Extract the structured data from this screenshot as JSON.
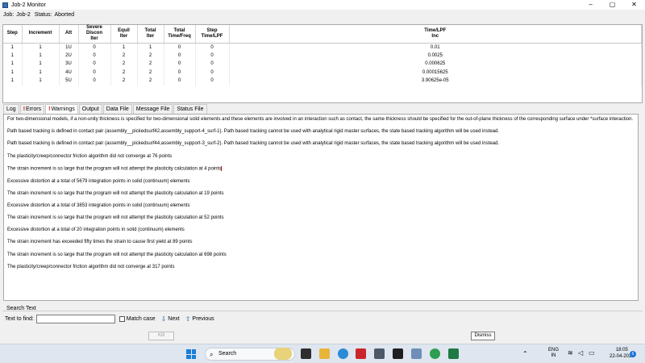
{
  "window": {
    "title": "Job-2 Monitor",
    "minimize": "–",
    "maximize": "▢",
    "close": "✕"
  },
  "job": {
    "job_label": "Job:",
    "job_value": "Job-2",
    "status_label": "Status:",
    "status_value": "Aborted"
  },
  "table": {
    "headers": [
      "Step",
      "Increment",
      "Att",
      "Severe\nDiscon\nIter",
      "Equil\nIter",
      "Total\nIter",
      "Total\nTime/Freq",
      "Step\nTime/LPF",
      "Time/LPF\nInc"
    ],
    "rows": [
      [
        "1",
        "1",
        "1U",
        "0",
        "1",
        "1",
        "0",
        "0",
        "0.01"
      ],
      [
        "1",
        "1",
        "2U",
        "0",
        "2",
        "2",
        "0",
        "0",
        "0.0025"
      ],
      [
        "1",
        "1",
        "3U",
        "0",
        "2",
        "2",
        "0",
        "0",
        "0.000625"
      ],
      [
        "1",
        "1",
        "4U",
        "0",
        "2",
        "2",
        "0",
        "0",
        "0.00015625"
      ],
      [
        "1",
        "1",
        "5U",
        "0",
        "2",
        "2",
        "0",
        "0",
        "3.90625e-05"
      ]
    ]
  },
  "tabs": [
    {
      "label": "Log",
      "excl": ""
    },
    {
      "label": "Errors",
      "excl": "!"
    },
    {
      "label": "Warnings",
      "excl": "!"
    },
    {
      "label": "Output",
      "excl": ""
    },
    {
      "label": "Data File",
      "excl": ""
    },
    {
      "label": "Message File",
      "excl": ""
    },
    {
      "label": "Status File",
      "excl": ""
    }
  ],
  "active_tab": "Warnings",
  "messages": [
    "For two-dimensional models, if a non-unity thickness is specified for two-dimensional solid elements and these elements are involved in an interaction such as contact, the same thickness should be specified for the out-of-plane thickness of the corresponding surface under *surface interaction.",
    "Path based tracking is defined in contact pair (assembly__pickedsurf42,assembly_support-4_surf-1). Path based tracking cannot be used with analytical rigid master surfaces, the state based tracking algorithm will be used instead.",
    "Path based tracking is defined in contact pair (assembly__pickedsurf44,assembly_support-3_surf-2). Path based tracking cannot be used with analytical rigid master surfaces, the state based tracking algorithm will be used instead.",
    "The plasticity/creep/connector friction algorithm did not converge at 76 points",
    "The strain increment is so large that the program will not attempt the plasticity calculation at 4 points",
    "Excessive distortion at a total of 5679 integration points in solid (continuum) elements",
    "The strain increment is so large that the program will not attempt the plasticity calculation at 19 points",
    "Excessive distortion at a total of 3853 integration points in solid (continuum) elements",
    "The strain increment is so large that the program will not attempt the plasticity calculation at 52 points",
    "Excessive distortion at a total of 20 integration points in solid (continuum) elements",
    "The strain increment has exceeded fifty times the strain to cause first yield at 89 points",
    "The strain increment is so large that the program will not attempt the plasticity calculation at 698 points",
    "The plasticity/creep/connector friction algorithm did not converge at 317 points"
  ],
  "search": {
    "section_label": "Search Text",
    "find_label": "Text to find:",
    "find_value": "",
    "match_case_label": "Match case",
    "next_label": "Next",
    "previous_label": "Previous"
  },
  "buttons": {
    "kill": "Kill",
    "dismiss": "Dismiss"
  },
  "taskbar": {
    "search_label": "Search",
    "lang": "ENG",
    "region": "IN",
    "time": "18:05",
    "date": "22-04-2023",
    "notifications": "6",
    "colors": {
      "bg": "#dfe6ef",
      "accent": "#1a73d9"
    }
  }
}
